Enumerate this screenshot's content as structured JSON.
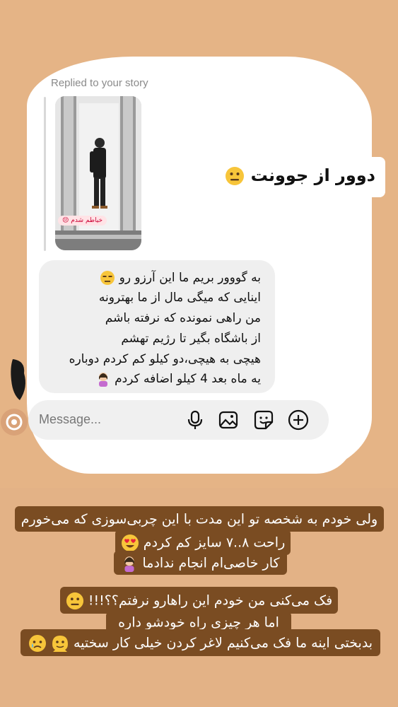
{
  "story": {
    "replied_label": "Replied to your story",
    "sticker_text": "خیاطم شدم 😒"
  },
  "floating": {
    "text": "دوور از جوونت"
  },
  "message": {
    "lines": [
      "به گووور بریم ما این آرزو رو",
      "اینایی که میگی مال از ما بهترونه",
      "من راهی نمونده که نرفته باشم",
      "از باشگاه بگیر تا رژیم تهشم",
      "هیچی به هیچی،دو کیلو کم کردم دوباره",
      "یه ماه بعد 4 کیلو اضافه کردم"
    ]
  },
  "composer": {
    "placeholder": "Message..."
  },
  "captions": {
    "block1": [
      "ولی خودم به شخصه تو این مدت با این چربی‌سوزی که می‌خورم",
      "راحت ۸..۷ سایز کم کردم",
      "کار خاصی‌ام انجام ندادما"
    ],
    "block2": [
      "فک می‌کنی من خودم این راهارو نرفتم؟؟!!!",
      "اما هر چیزی راه خودشو داره",
      "بدبختی اینه ما فک می‌کنیم لاغر کردن خیلی کار سختیه"
    ]
  },
  "icons": {
    "microphone": "mic-icon",
    "gallery": "image-icon",
    "sticker": "sticker-icon",
    "plus": "plus-circle-icon"
  }
}
